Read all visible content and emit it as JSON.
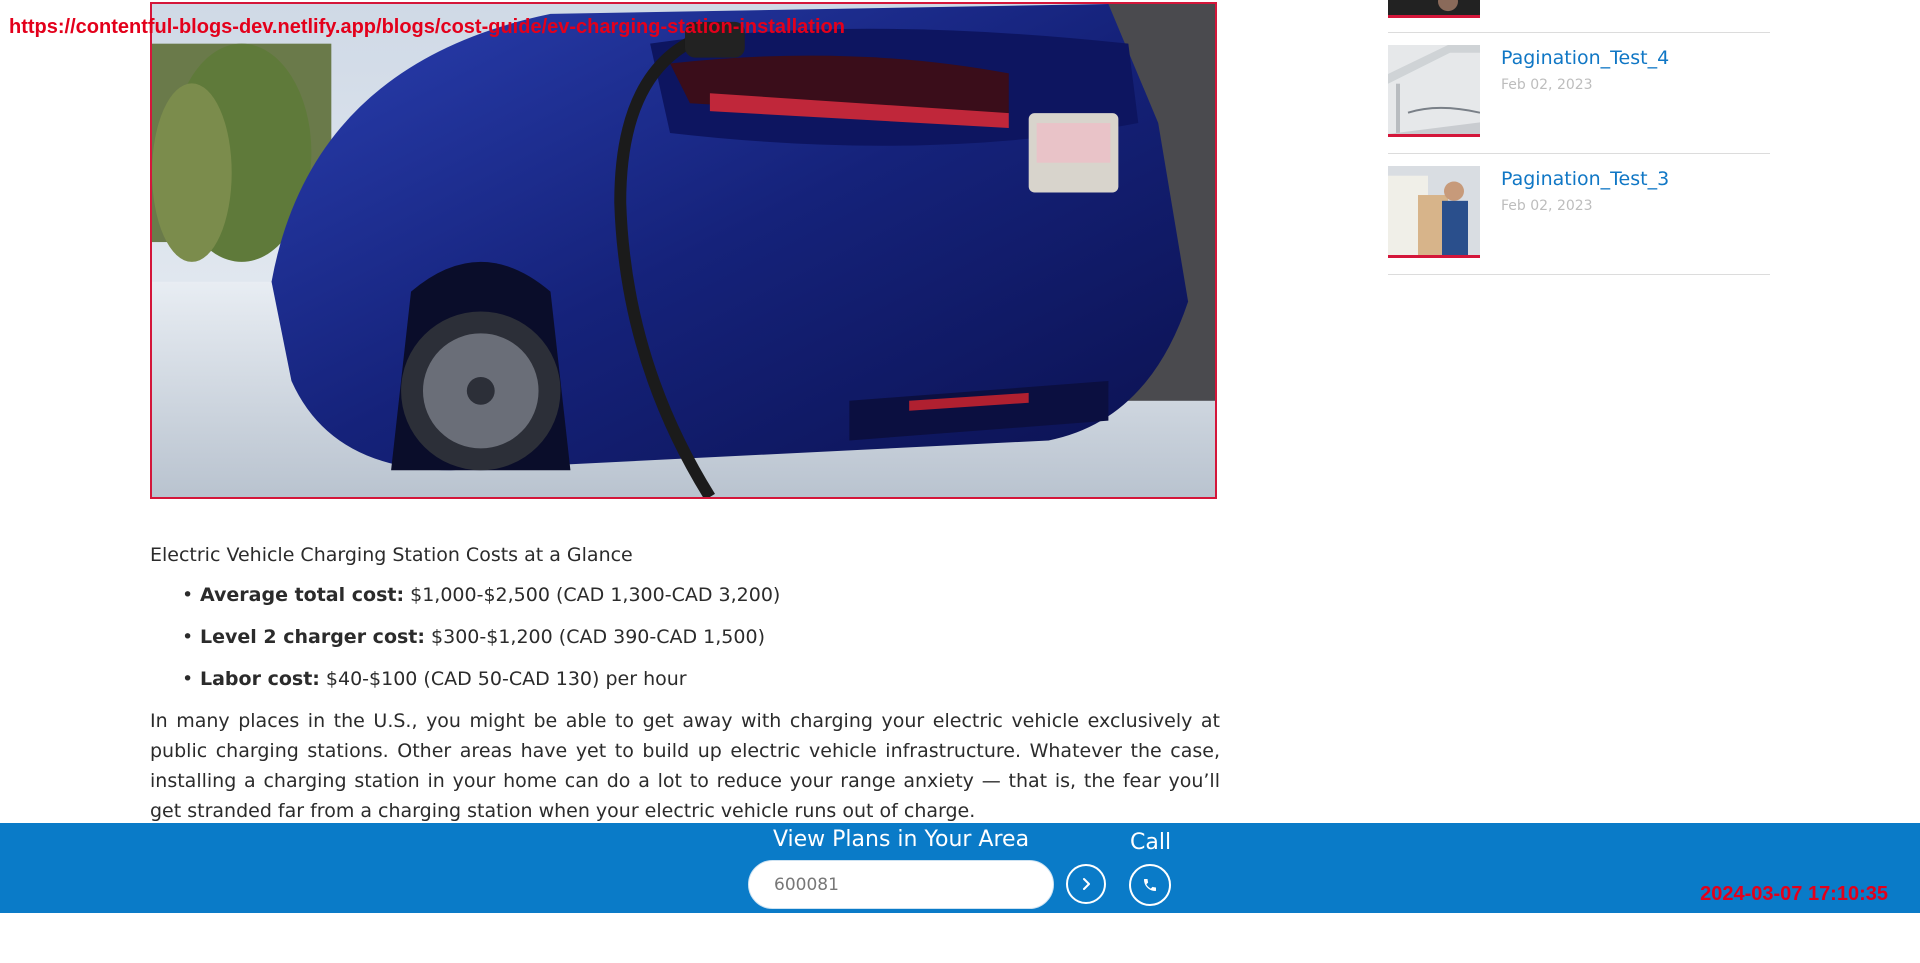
{
  "browser": {
    "url": "https://contentful-blogs-dev.netlify.app/blogs/cost-guide/ev-charging-station-installation",
    "timestamp": "2024-03-07 17:10:35"
  },
  "article": {
    "hero_image": "blue-electric-car-charging-photo",
    "section_title": "Electric Vehicle Charging Station Costs at a Glance",
    "bullets": [
      {
        "label": "Average total cost:",
        "text": "$1,000-$2,500 (CAD 1,300-CAD 3,200)"
      },
      {
        "label": "Level 2 charger cost:",
        "text": "$300-$1,200 (CAD 390-CAD 1,500)"
      },
      {
        "label": "Labor cost:",
        "text": "$40-$100 (CAD 50-CAD 130) per hour"
      }
    ],
    "paragraph": "In many places in the U.S., you might be able to get away with charging your electric vehicle exclusively at public charging stations. Other areas have yet to build up electric vehicle infrastructure. Whatever the case, installing a charging station in your home can do a lot to reduce your range anxiety — that is, the fear you’ll get stranded far from a charging station when your electric vehicle runs out of charge."
  },
  "sidebar": {
    "posts": [
      {
        "title": "Pagination_Test_4",
        "date": "Feb 02, 2023",
        "thumb": "house-gutter-photo"
      },
      {
        "title": "Pagination_Test_3",
        "date": "Feb 02, 2023",
        "thumb": "technician-at-appliance-photo"
      }
    ]
  },
  "cta": {
    "title": "View Plans in Your Area",
    "zip_value": "600081",
    "call_label": "Call",
    "go_icon": "chevron-right-icon",
    "call_icon": "phone-icon"
  },
  "colors": {
    "accent_blue": "#0a7bc8",
    "link_blue": "#1077c5",
    "overlay_red": "#e3001b",
    "thumb_border_red": "#d4163a"
  }
}
